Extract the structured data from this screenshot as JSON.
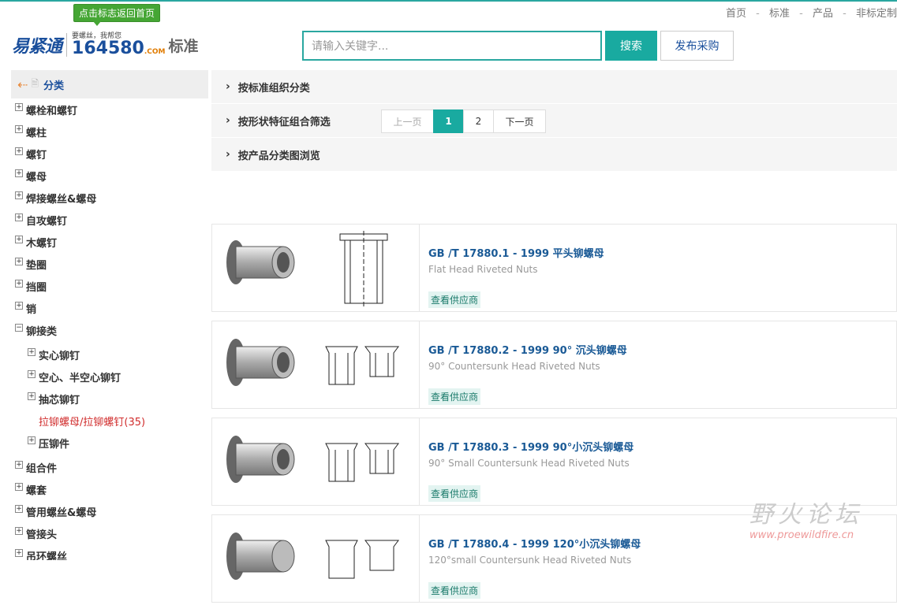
{
  "top_nav": [
    "首页",
    "标准",
    "产品",
    "非标定制"
  ],
  "logo": {
    "tooltip": "点击标志返回首页",
    "brand": "易紧通",
    "slogan": "要螺丝，我帮您",
    "number": "164580",
    "domain": ".COM",
    "section": "标准"
  },
  "search": {
    "placeholder": "请输入关键字...",
    "button": "搜索",
    "post_button": "发布采购"
  },
  "sidebar": {
    "title": "分类",
    "items": [
      {
        "label": "螺栓和螺钉",
        "mark": "+"
      },
      {
        "label": "螺柱",
        "mark": "+"
      },
      {
        "label": "螺钉",
        "mark": "+"
      },
      {
        "label": "螺母",
        "mark": "+"
      },
      {
        "label": "焊接螺丝&螺母",
        "mark": "+"
      },
      {
        "label": "自攻螺钉",
        "mark": "+"
      },
      {
        "label": "木螺钉",
        "mark": "+"
      },
      {
        "label": "垫圈",
        "mark": "+"
      },
      {
        "label": "挡圈",
        "mark": "+"
      },
      {
        "label": "销",
        "mark": "+"
      },
      {
        "label": "铆接类",
        "mark": "−"
      }
    ],
    "subitems": [
      {
        "label": "实心铆钉",
        "mark": "+"
      },
      {
        "label": "空心、半空心铆钉",
        "mark": "+"
      },
      {
        "label": "抽芯铆钉",
        "mark": "+"
      }
    ],
    "active_item": "拉铆螺母/拉铆螺钉(35)",
    "subitems_after": [
      {
        "label": "压铆件",
        "mark": "+"
      }
    ],
    "items_after": [
      {
        "label": "组合件",
        "mark": "+"
      },
      {
        "label": "螺套",
        "mark": "+"
      },
      {
        "label": "管用螺丝&螺母",
        "mark": "+"
      },
      {
        "label": "管接头",
        "mark": "+"
      },
      {
        "label": "吊环螺丝",
        "mark": "+"
      }
    ]
  },
  "filters": [
    "按标准组织分类",
    "按形状特征组合筛选",
    "按产品分类图浏览"
  ],
  "pager": {
    "prev": "上一页",
    "pages": [
      "1",
      "2"
    ],
    "current": "1",
    "next": "下一页"
  },
  "products": [
    {
      "name": "GB /T 17880.1 - 1999 平头铆螺母",
      "en": "Flat Head Riveted Nuts",
      "supplier": "查看供应商"
    },
    {
      "name": "GB /T 17880.2 - 1999 90° 沉头铆螺母",
      "en": "90° Countersunk Head Riveted Nuts",
      "supplier": "查看供应商"
    },
    {
      "name": "GB /T 17880.3 - 1999 90°小沉头铆螺母",
      "en": "90° Small Countersunk Head Riveted Nuts",
      "supplier": "查看供应商"
    },
    {
      "name": "GB /T 17880.4 - 1999 120°小沉头铆螺母",
      "en": "120°small Countersunk Head Riveted Nuts",
      "supplier": "查看供应商"
    }
  ],
  "watermark": {
    "cn": "野火论坛",
    "url": "www.proewildfire.cn"
  }
}
